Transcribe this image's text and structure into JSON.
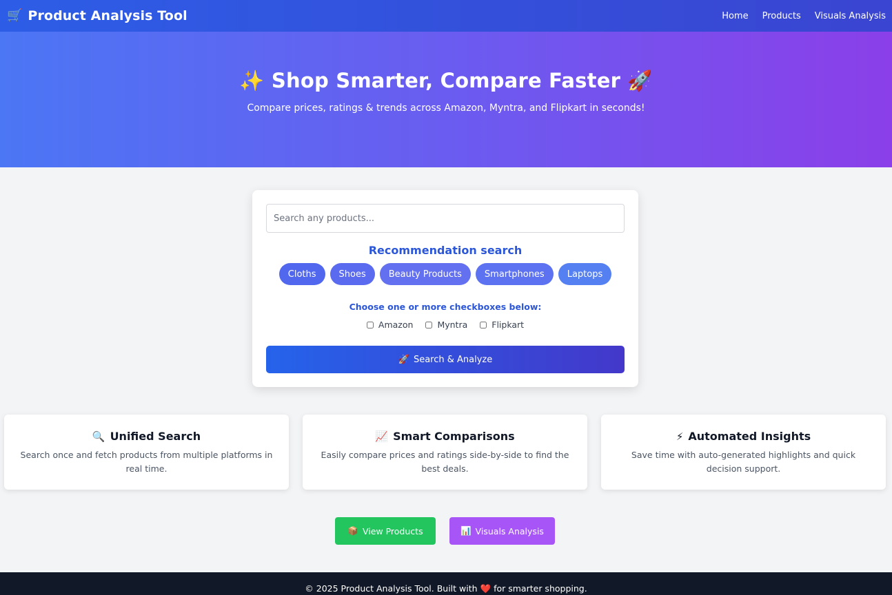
{
  "navbar": {
    "brand_icon": "🛒",
    "brand_title": "Product Analysis Tool",
    "links": [
      "Home",
      "Products",
      "Visuals Analysis"
    ]
  },
  "hero": {
    "title": "✨ Shop Smarter, Compare Faster 🚀",
    "subtitle": "Compare prices, ratings & trends across Amazon, Myntra, and Flipkart in seconds!"
  },
  "search": {
    "placeholder": "Search any products...",
    "recommendation_title": "Recommendation search",
    "chips": [
      "Cloths",
      "Shoes",
      "Beauty Products",
      "Smartphones",
      "Laptops"
    ],
    "choose_text": "Choose one or more checkboxes below:",
    "platforms": [
      "Amazon",
      "Myntra",
      "Flipkart"
    ],
    "button_icon": "🚀",
    "button_label": "Search & Analyze"
  },
  "features": [
    {
      "icon": "🔍",
      "title": "Unified Search",
      "desc": "Search once and fetch products from multiple platforms in real time."
    },
    {
      "icon": "📈",
      "title": "Smart Comparisons",
      "desc": "Easily compare prices and ratings side-by-side to find the best deals."
    },
    {
      "icon": "⚡",
      "title": "Automated Insights",
      "desc": "Save time with auto-generated highlights and quick decision support."
    }
  ],
  "actions": {
    "view_products_icon": "📦",
    "view_products": "View Products",
    "visuals_icon": "📊",
    "visuals": "Visuals Analysis"
  },
  "footer": {
    "text_before": "© 2025 Product Analysis Tool. Built with",
    "heart": "❤️",
    "text_after": "for smarter shopping."
  },
  "colors": {
    "nav": "#2d5de6",
    "accent_blue": "#2b56d8",
    "green": "#22c55e",
    "purple": "#a855f7",
    "footer": "#111827"
  }
}
